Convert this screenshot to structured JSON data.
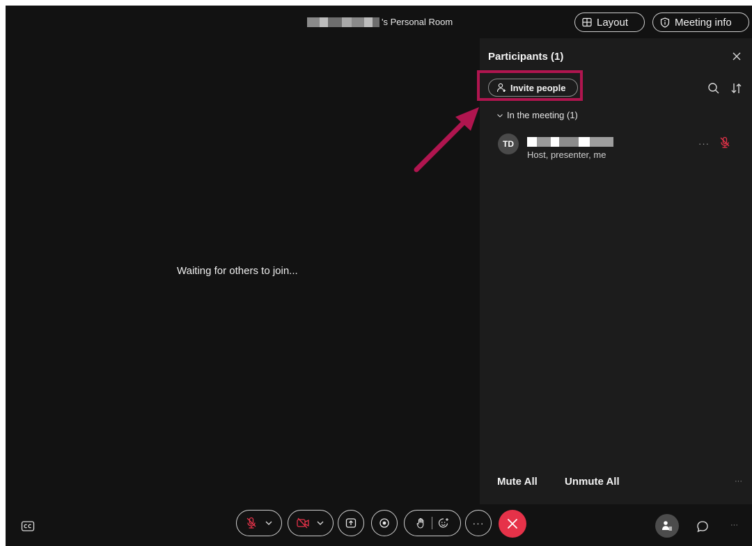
{
  "header": {
    "room_title_suffix": "'s Personal Room",
    "layout_label": "Layout",
    "meeting_info_label": "Meeting info"
  },
  "stage": {
    "waiting_text": "Waiting for others to join..."
  },
  "participants_panel": {
    "title": "Participants (1)",
    "invite_label": "Invite people",
    "section_label": "In the meeting (1)",
    "participants": [
      {
        "initials": "TD",
        "role": "Host, presenter, me",
        "more": "···"
      }
    ],
    "mute_all_label": "Mute All",
    "unmute_all_label": "Unmute All",
    "more": "···"
  },
  "toolbar": {
    "more": "···",
    "right_more": "···"
  },
  "colors": {
    "background": "#121212",
    "panel": "#1c1c1c",
    "muted_red": "#e63249",
    "highlight": "#b0154f"
  },
  "icons": {
    "layout": "layout-grid-icon",
    "meeting_info": "shield-info-icon",
    "close": "close-icon",
    "invite": "add-person-icon",
    "search": "search-icon",
    "sort": "sort-icon",
    "section": "chevron-down-icon",
    "mic_muted": "mic-muted-icon",
    "camera_off": "camera-off-icon",
    "share": "share-icon",
    "record": "record-icon",
    "raise_hand": "raise-hand-icon",
    "reaction": "reaction-icon",
    "leave": "leave-x-icon",
    "participants": "participants-icon",
    "chat": "chat-icon",
    "captions": "closed-captions-icon"
  }
}
